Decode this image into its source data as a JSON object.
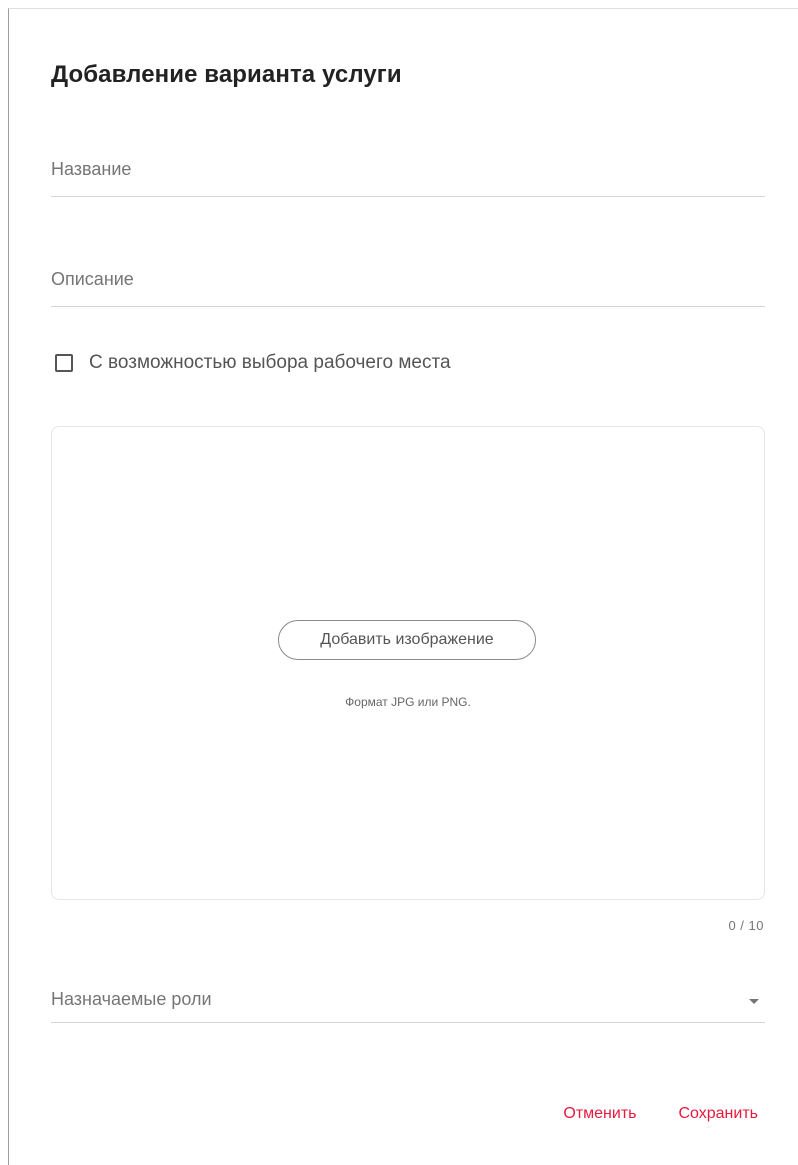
{
  "dialog": {
    "title": "Добавление варианта услуги"
  },
  "fields": {
    "name_label": "Название",
    "description_label": "Описание"
  },
  "checkbox": {
    "label": "С возможностью выбора рабочего места",
    "checked": false
  },
  "upload": {
    "button_label": "Добавить изображение",
    "hint": "Формат JPG или PNG.",
    "counter": "0 / 10"
  },
  "roles": {
    "label": "Назначаемые роли",
    "icon": "chevron-down-icon"
  },
  "actions": {
    "cancel_label": "Отменить",
    "save_label": "Сохранить",
    "accent_color": "#e8193c"
  }
}
